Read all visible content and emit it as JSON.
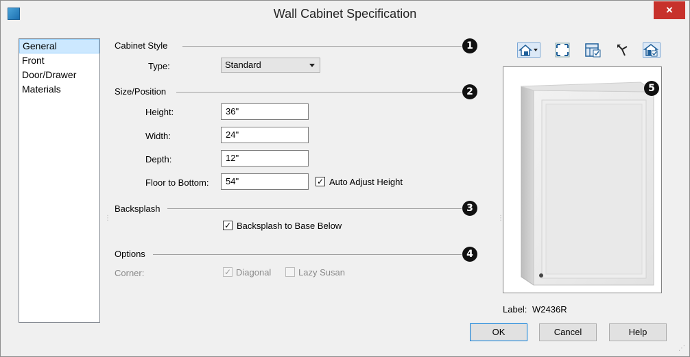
{
  "window": {
    "title": "Wall Cabinet Specification",
    "close_glyph": "×"
  },
  "nav": {
    "items": [
      "General",
      "Front",
      "Door/Drawer",
      "Materials"
    ]
  },
  "cabinet_style": {
    "title": "Cabinet Style",
    "type_label": "Type:",
    "type_value": "Standard",
    "callout": "1"
  },
  "size_position": {
    "title": "Size/Position",
    "height_label": "Height:",
    "height_value": "36\"",
    "width_label": "Width:",
    "width_value": "24\"",
    "depth_label": "Depth:",
    "depth_value": "12\"",
    "floor_label": "Floor to Bottom:",
    "floor_value": "54\"",
    "auto_adjust_label": "Auto Adjust Height",
    "auto_adjust_checked": true,
    "callout": "2"
  },
  "backsplash": {
    "title": "Backsplash",
    "option_label": "Backsplash to Base Below",
    "option_checked": true,
    "callout": "3"
  },
  "options": {
    "title": "Options",
    "corner_label": "Corner:",
    "diagonal_label": "Diagonal",
    "diagonal_checked": true,
    "lazy_susan_label": "Lazy Susan",
    "lazy_susan_checked": false,
    "callout": "4"
  },
  "preview": {
    "callout": "5",
    "label_caption": "Label:",
    "label_value": "W2436R",
    "toolbar_icons": [
      "view-type-icon",
      "fit-window-icon",
      "show-surfaces-icon",
      "orbit-icon",
      "color-view-icon"
    ]
  },
  "buttons": {
    "ok": "OK",
    "cancel": "Cancel",
    "help": "Help"
  },
  "colors": {
    "accent": "#0078d7",
    "close": "#c7312b",
    "selection": "#cce8ff"
  }
}
